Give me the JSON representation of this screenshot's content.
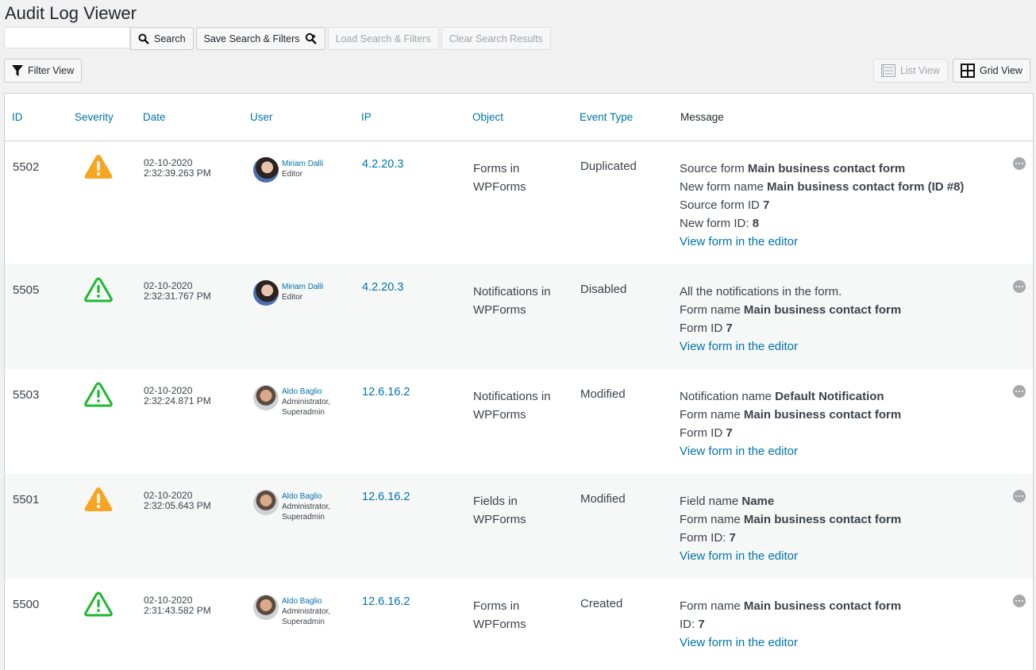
{
  "header": {
    "title": "Audit Log Viewer"
  },
  "toolbar": {
    "search_placeholder": "",
    "search_value": "",
    "search_label": "Search",
    "save_label": "Save Search & Filters",
    "load_label": "Load Search & Filters",
    "clear_label": "Clear Search Results",
    "filter_label": "Filter View",
    "list_view_label": "List View",
    "grid_view_label": "Grid View"
  },
  "table": {
    "headers": {
      "id": "ID",
      "severity": "Severity",
      "date": "Date",
      "user": "User",
      "ip": "IP",
      "object": "Object",
      "event_type": "Event Type",
      "message": "Message"
    },
    "rows": [
      {
        "id": "5502",
        "severity": "warning",
        "severity_color": "#f6a623",
        "date": "02-10-2020",
        "time": "2:32:39.263 PM",
        "user_name": "Miriam Dalli",
        "user_role1": "Editor",
        "user_role2": "",
        "ip": "4.2.20.3",
        "object_line1": "Forms in",
        "object_line2": "WPForms",
        "event_type": "Duplicated",
        "msg": [
          {
            "label": "Source form ",
            "value": "Main business contact form"
          },
          {
            "label": "New form name ",
            "value": "Main business contact form (ID #8)"
          },
          {
            "label": "Source form ID ",
            "value": "7"
          },
          {
            "label": "New form ID: ",
            "value": "8"
          }
        ],
        "link": "View form in the editor"
      },
      {
        "id": "5505",
        "severity": "low",
        "severity_color": "#1fb832",
        "date": "02-10-2020",
        "time": "2:32:31.767 PM",
        "user_name": "Miriam Dalli",
        "user_role1": "Editor",
        "user_role2": "",
        "ip": "4.2.20.3",
        "object_line1": "Notifications in",
        "object_line2": "WPForms",
        "event_type": "Disabled",
        "msg": [
          {
            "label": "All the notifications in the form.",
            "value": ""
          },
          {
            "label": "Form name ",
            "value": "Main business contact form"
          },
          {
            "label": "Form ID ",
            "value": "7"
          }
        ],
        "link": "View form in the editor"
      },
      {
        "id": "5503",
        "severity": "low",
        "severity_color": "#1fb832",
        "date": "02-10-2020",
        "time": "2:32:24.871 PM",
        "user_name": "Aldo Baglio",
        "user_role1": "Administrator,",
        "user_role2": "Superadmin",
        "ip": "12.6.16.2",
        "object_line1": "Notifications in",
        "object_line2": "WPForms",
        "event_type": "Modified",
        "msg": [
          {
            "label": "Notification name ",
            "value": "Default Notification"
          },
          {
            "label": "Form name ",
            "value": "Main business contact form"
          },
          {
            "label": "Form ID ",
            "value": "7"
          }
        ],
        "link": "View form in the editor"
      },
      {
        "id": "5501",
        "severity": "warning",
        "severity_color": "#f6a623",
        "date": "02-10-2020",
        "time": "2:32:05.643 PM",
        "user_name": "Aldo Baglio",
        "user_role1": "Administrator,",
        "user_role2": "Superadmin",
        "ip": "12.6.16.2",
        "object_line1": "Fields in",
        "object_line2": "WPForms",
        "event_type": "Modified",
        "msg": [
          {
            "label": "Field name ",
            "value": "Name"
          },
          {
            "label": "Form name ",
            "value": "Main business contact form"
          },
          {
            "label": "Form ID: ",
            "value": "7"
          }
        ],
        "link": "View form in the editor"
      },
      {
        "id": "5500",
        "severity": "low",
        "severity_color": "#1fb832",
        "date": "02-10-2020",
        "time": "2:31:43.582 PM",
        "user_name": "Aldo Baglio",
        "user_role1": "Administrator,",
        "user_role2": "Superadmin",
        "ip": "12.6.16.2",
        "object_line1": "Forms in",
        "object_line2": "WPForms",
        "event_type": "Created",
        "msg": [
          {
            "label": "Form name ",
            "value": "Main business contact form"
          },
          {
            "label": "ID: ",
            "value": "7"
          }
        ],
        "link": "View form in the editor"
      }
    ]
  }
}
